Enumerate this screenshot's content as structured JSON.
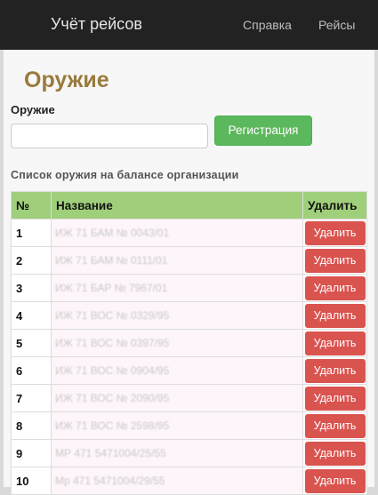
{
  "navbar": {
    "brand": "Учёт рейсов",
    "links": [
      "Справка",
      "Рейсы"
    ]
  },
  "page": {
    "title": "Оружие"
  },
  "form": {
    "label": "Оружие",
    "input_value": "",
    "register_button": "Регистрация"
  },
  "list": {
    "title": "Список оружия на балансе организации",
    "headers": [
      "№",
      "Название",
      "Удалить"
    ],
    "delete_label": "Удалить",
    "rows": [
      {
        "num": "1",
        "name": "ИЖ 71 БАМ № 0043/01"
      },
      {
        "num": "2",
        "name": "ИЖ 71 БАМ № 0111/01"
      },
      {
        "num": "3",
        "name": "ИЖ 71 БАР № 7967/01"
      },
      {
        "num": "4",
        "name": "ИЖ 71 ВОС № 0329/95"
      },
      {
        "num": "5",
        "name": "ИЖ 71 ВОС № 0397/95"
      },
      {
        "num": "6",
        "name": "ИЖ 71 ВОС № 0904/95"
      },
      {
        "num": "7",
        "name": "ИЖ 71 ВОС № 2090/95"
      },
      {
        "num": "8",
        "name": "ИЖ 71 ВОС № 2598/95"
      },
      {
        "num": "9",
        "name": "МР 471 5471004/25/55"
      },
      {
        "num": "10",
        "name": "Мр 471 5471004/29/55"
      }
    ]
  },
  "colors": {
    "navbar_bg": "#222222",
    "title": "#9a7a3c",
    "success": "#5cb85c",
    "danger": "#d9534f",
    "table_header": "#9fcf7a"
  }
}
